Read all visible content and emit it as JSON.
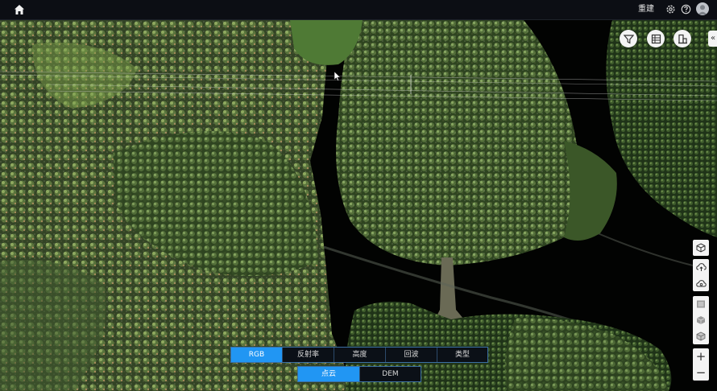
{
  "header": {
    "rebuild_label": "重建",
    "settings_icon": "gear-icon",
    "help_icon": "help-icon",
    "avatar_icon": "user-avatar-icon"
  },
  "toolbar_right": {
    "filter_icon": "filter-icon",
    "table_icon": "table-icon",
    "building_icon": "building-icon",
    "collapse_label": "«"
  },
  "side_tools": {
    "zoom_in": "+",
    "zoom_out": "−"
  },
  "color_modes": [
    "RGB",
    "反射率",
    "高度",
    "回波",
    "类型"
  ],
  "color_mode_active": "RGB",
  "data_modes": [
    "点云",
    "DEM"
  ],
  "data_mode_active": "点云",
  "colors": {
    "accent": "#2196f3",
    "topbar": "#0c0e14",
    "button_bg": "#f4f4f4"
  }
}
